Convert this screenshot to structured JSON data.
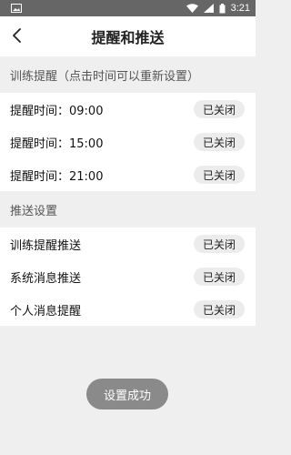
{
  "status_bar": {
    "time": "3:21",
    "icons": [
      "image-icon",
      "wifi-icon",
      "signal-icon",
      "battery-icon"
    ]
  },
  "header": {
    "title": "提醒和推送",
    "back_icon": "chevron-left-icon"
  },
  "sections": [
    {
      "title": "训练提醒（点击时间可以重新设置）",
      "rows": [
        {
          "label": "提醒时间：09:00",
          "status": "已关闭"
        },
        {
          "label": "提醒时间：15:00",
          "status": "已关闭"
        },
        {
          "label": "提醒时间：21:00",
          "status": "已关闭"
        }
      ]
    },
    {
      "title": "推送设置",
      "rows": [
        {
          "label": "训练提醒推送",
          "status": "已关闭"
        },
        {
          "label": "系统消息推送",
          "status": "已关闭"
        },
        {
          "label": "个人消息提醒",
          "status": "已关闭"
        }
      ]
    }
  ],
  "toast": {
    "text": "设置成功"
  },
  "colors": {
    "status_bar": "#666666",
    "background": "#efefef",
    "badge": "#ececec",
    "toast": "#8a8a8a"
  }
}
